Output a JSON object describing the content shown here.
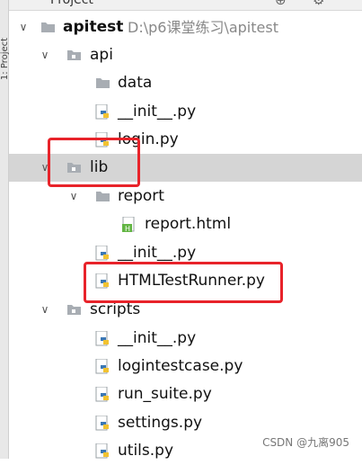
{
  "header": {
    "title": "Project"
  },
  "strip": {
    "label": "1: Project"
  },
  "tree": [
    {
      "label": "apitest",
      "path": "D:\\p6课堂练习\\apitest",
      "type": "folder",
      "arrow": "down",
      "bold": true
    },
    {
      "label": "api",
      "type": "folder",
      "arrow": "down"
    },
    {
      "label": "data",
      "type": "folder"
    },
    {
      "label": "__init__.py",
      "type": "python"
    },
    {
      "label": "login.py",
      "type": "python"
    },
    {
      "label": "lib",
      "type": "folder",
      "arrow": "down",
      "selected": true
    },
    {
      "label": "report",
      "type": "folder",
      "arrow": "down"
    },
    {
      "label": "report.html",
      "type": "html"
    },
    {
      "label": "__init__.py",
      "type": "python"
    },
    {
      "label": "HTMLTestRunner.py",
      "type": "python"
    },
    {
      "label": "scripts",
      "type": "folder",
      "arrow": "down"
    },
    {
      "label": "__init__.py",
      "type": "python"
    },
    {
      "label": "logintestcase.py",
      "type": "python"
    },
    {
      "label": "run_suite.py",
      "type": "python"
    },
    {
      "label": "settings.py",
      "type": "python"
    },
    {
      "label": "utils.py",
      "type": "python"
    }
  ],
  "watermark": "CSDN @九离905",
  "colors": {
    "highlight": "#e8232a",
    "selection": "#d5d5d5"
  }
}
